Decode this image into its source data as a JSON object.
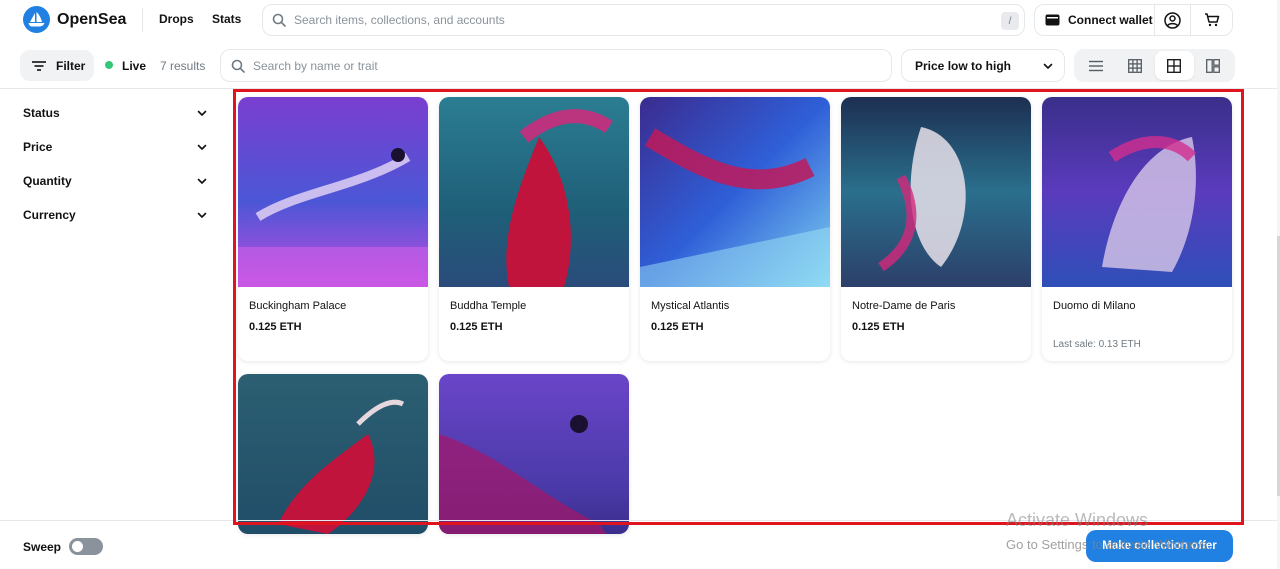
{
  "colors": {
    "accent": "#2081e2",
    "live": "#34c77b",
    "highlight": "#e0141e"
  },
  "header": {
    "brand": "OpenSea",
    "nav": [
      "Drops",
      "Stats"
    ],
    "search_placeholder": "Search items, collections, and accounts",
    "search_shortcut": "/",
    "connect_wallet": "Connect wallet",
    "icons": [
      "opensea-logo-icon",
      "search-icon",
      "wallet-icon",
      "profile-icon",
      "cart-icon"
    ]
  },
  "toolbar": {
    "filter_label": "Filter",
    "live_label": "Live",
    "results": "7 results",
    "search_placeholder": "Search by name or trait",
    "sort_label": "Price low to high",
    "view_modes": [
      "list",
      "grid-small",
      "grid-medium",
      "grid-large"
    ],
    "active_view": "grid-medium"
  },
  "sidebar": {
    "items": [
      {
        "label": "Status"
      },
      {
        "label": "Price"
      },
      {
        "label": "Quantity"
      },
      {
        "label": "Currency"
      }
    ]
  },
  "items": [
    {
      "name": "Buckingham Palace",
      "price": "0.125 ETH",
      "last_sale": ""
    },
    {
      "name": "Buddha Temple",
      "price": "0.125 ETH",
      "last_sale": ""
    },
    {
      "name": "Mystical Atlantis",
      "price": "0.125 ETH",
      "last_sale": ""
    },
    {
      "name": "Notre-Dame de Paris",
      "price": "0.125 ETH",
      "last_sale": ""
    },
    {
      "name": "Duomo di Milano",
      "price": "",
      "last_sale": "Last sale: 0.13 ETH"
    },
    {
      "name": "",
      "price": "",
      "last_sale": ""
    },
    {
      "name": "",
      "price": "",
      "last_sale": ""
    }
  ],
  "footer": {
    "sweep_label": "Sweep",
    "offer_button": "Make collection offer",
    "sweep_enabled": false
  },
  "watermark": {
    "title": "Activate Windows",
    "subtitle": "Go to Settings to activate Windows."
  }
}
